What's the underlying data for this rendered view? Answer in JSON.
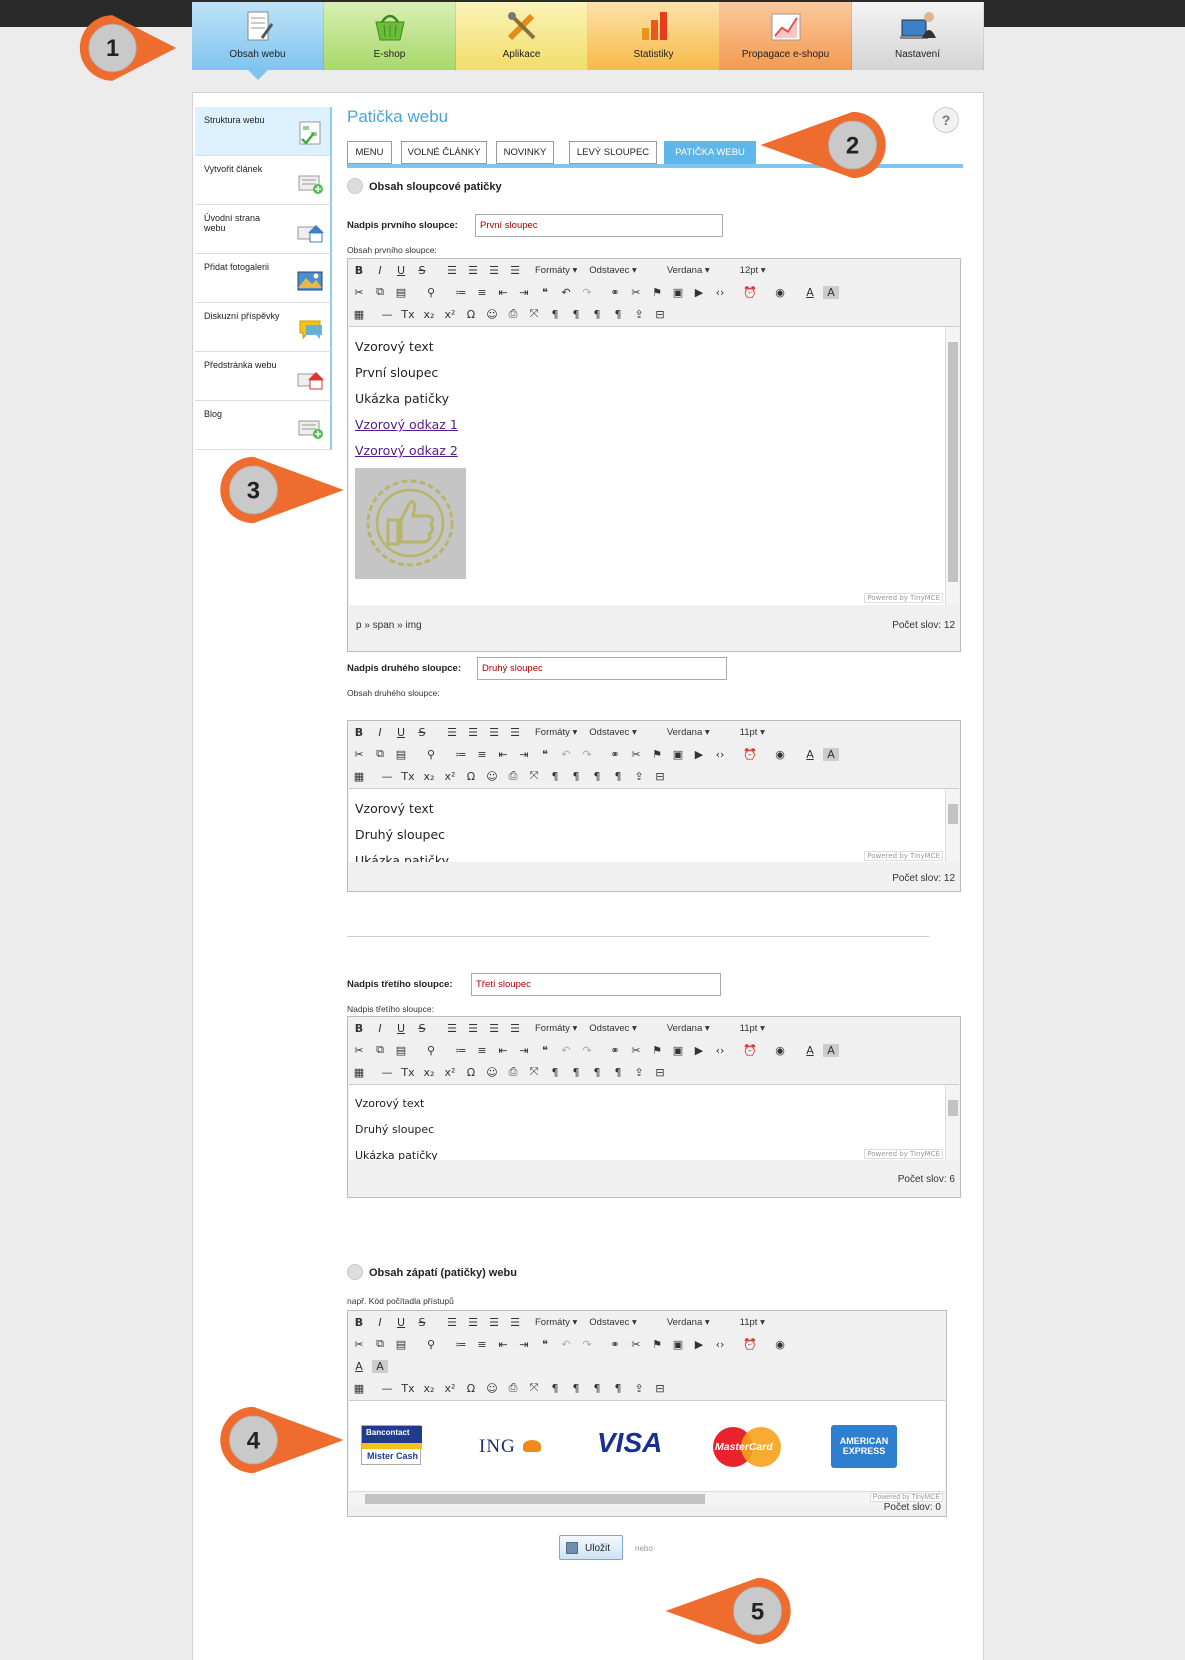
{
  "nav": {
    "tabs": [
      {
        "label": "Obsah webu",
        "icon": "document-edit-icon"
      },
      {
        "label": "E-shop",
        "icon": "basket-icon"
      },
      {
        "label": "Aplikace",
        "icon": "tools-icon"
      },
      {
        "label": "Statistiky",
        "icon": "bar-chart-icon"
      },
      {
        "label": "Propagace e-shopu",
        "icon": "growth-chart-icon"
      },
      {
        "label": "Nastavení",
        "icon": "person-laptop-icon"
      }
    ]
  },
  "sidebar": {
    "items": [
      {
        "label": "Struktura webu",
        "icon": "structure-icon"
      },
      {
        "label": "Vytvořit článek",
        "icon": "add-article-icon"
      },
      {
        "label": "Úvodní strana webu",
        "icon": "home-icon"
      },
      {
        "label": "Přidat fotogalerii",
        "icon": "gallery-icon"
      },
      {
        "label": "Diskuzní příspěvky",
        "icon": "speech-bubble-icon"
      },
      {
        "label": "Předstránka webu",
        "icon": "home-icon"
      },
      {
        "label": "Blog",
        "icon": "add-article-icon"
      }
    ]
  },
  "page": {
    "title": "Patička webu",
    "help": "?"
  },
  "subtabs": [
    "MENU",
    "VOLNÉ ČLÁNKY",
    "NOVINKY",
    "LEVÝ SLOUPEC",
    "PATIČKA WEBU"
  ],
  "section1": {
    "title": "Obsah sloupcové patičky"
  },
  "col1": {
    "title_label": "Nadpis prvního sloupce:",
    "title_value": "První sloupec",
    "content_label": "Obsah prvního sloupce:",
    "font_size": "12pt",
    "lines": [
      "Vzorový text",
      "První sloupec",
      "Ukázka patičky"
    ],
    "links": [
      "Vzorový odkaz 1",
      "Vzorový odkaz 2"
    ],
    "path": "p » span » img",
    "wordcount": "Počet slov: 12"
  },
  "col2": {
    "title_label": "Nadpis druhého sloupce:",
    "title_value": "Druhý sloupec",
    "content_label": "Obsah druhého sloupce:",
    "font_size": "11pt",
    "lines": [
      "Vzorový text",
      "Druhý sloupec",
      "Ukázka patičky"
    ],
    "wordcount": "Počet slov: 12"
  },
  "col3": {
    "title_label": "Nadpis třetího sloupce:",
    "title_value": "Třetí sloupec",
    "content_label": "Nadpis třetího sloupce:",
    "font_size": "11pt",
    "lines": [
      "Vzorový text",
      "Druhý sloupec",
      "Ukázka patičky"
    ],
    "wordcount": "Počet slov: 6"
  },
  "section2": {
    "title": "Obsah zápatí (patičky) webu",
    "hint": "např. Kód počítadla přístupů"
  },
  "footer_editor": {
    "font_size": "11pt",
    "wordcount": "Počet slov: 0",
    "logos": {
      "bancontact1": "Bancontact",
      "bancontact2": "Mister Cash",
      "ing": "ING",
      "visa": "VISA",
      "mastercard": "MasterCard",
      "amex1": "AMERICAN",
      "amex2": "EXPRESS"
    }
  },
  "toolbar": {
    "formats": "Formáty",
    "paragraph": "Odstavec",
    "font": "Verdana",
    "powered": "Powered by TinyMCE"
  },
  "actions": {
    "save": "Uložit",
    "or": "nebo"
  },
  "callouts": [
    "1",
    "2",
    "3",
    "4",
    "5"
  ],
  "colors": {
    "accent": "#4aa3db",
    "callout": "#ee6c2d",
    "callout_inner": "#c9c9c9"
  }
}
